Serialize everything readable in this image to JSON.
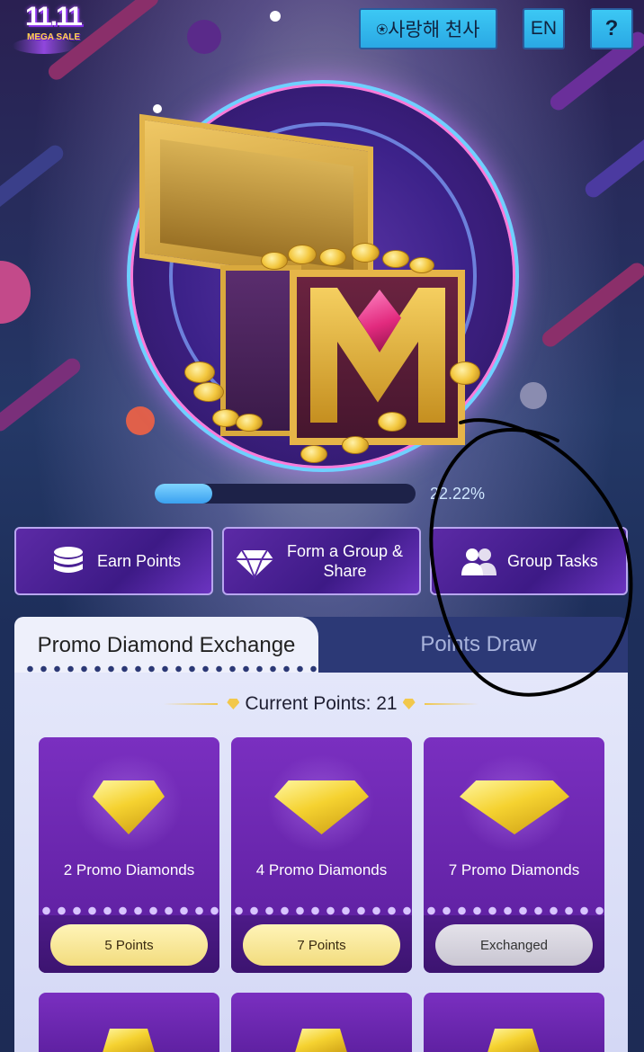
{
  "header": {
    "logo_main": "11.11",
    "logo_sub": "MEGA SALE",
    "user_button": "⍟사랑해 천사",
    "lang_button": "EN",
    "help_button": "?"
  },
  "progress": {
    "value": 0.2222,
    "label": "22.22%"
  },
  "actions": [
    {
      "label": "Earn Points",
      "icon": "coins-stack-icon"
    },
    {
      "label_line1": "Form a Group &",
      "label_line2": "Share",
      "icon": "diamond-icon"
    },
    {
      "label": "Group Tasks",
      "icon": "group-people-icon"
    }
  ],
  "tabs": [
    {
      "label": "Promo Diamond Exchange",
      "active": true
    },
    {
      "label": "Points Draw",
      "active": false
    }
  ],
  "current_points": {
    "label": "Current Points: 21"
  },
  "rewards": [
    {
      "name": "2 Promo Diamonds",
      "button": "5 Points",
      "exchanged": false
    },
    {
      "name": "4 Promo Diamonds",
      "button": "7 Points",
      "exchanged": false
    },
    {
      "name": "7 Promo Diamonds",
      "button": "Exchanged",
      "exchanged": true
    }
  ],
  "colors": {
    "accent_blue": "#3cc8f4",
    "panel": "#2c3976",
    "card_purple": "#7a2fc0",
    "pill_gold": "#f2dc7e"
  }
}
